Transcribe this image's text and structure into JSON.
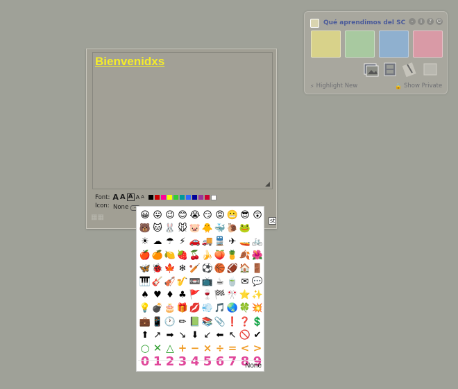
{
  "widget": {
    "title": "Qué aprendimos del SC",
    "swatch_colors": [
      "#d8d28a",
      "#a8c9a0",
      "#8fb0cf",
      "#d99aa6"
    ],
    "controls": [
      "-",
      "i",
      "?",
      "⏻"
    ],
    "highlight_label": "Highlight New",
    "show_label": "Show Private"
  },
  "note": {
    "heading": "Bienvenidxs",
    "heading_color": "#f4ec2a",
    "font_label": "Font:",
    "font_sizes": [
      "A",
      "A",
      "A",
      "A",
      "A"
    ],
    "colors": [
      "#000000",
      "#cc0000",
      "#ff0099",
      "#ffff00",
      "#33cc33",
      "#009999",
      "#3366ff",
      "#000099",
      "#993399",
      "#cc0033",
      "#ffffff"
    ],
    "icon_label": "Icon:",
    "icon_value": "None",
    "more_label": "...",
    "tail_text": "st"
  },
  "picker": {
    "rows": [
      [
        {
          "t": "😀"
        },
        {
          "t": "😛"
        },
        {
          "t": "😉"
        },
        {
          "t": "😊"
        },
        {
          "t": "😭"
        },
        {
          "t": "😏"
        },
        {
          "t": "😡"
        },
        {
          "t": "😬"
        },
        {
          "t": "😎"
        },
        {
          "t": "😲"
        }
      ],
      [
        {
          "t": "🐻"
        },
        {
          "t": "🐱"
        },
        {
          "t": "🐰"
        },
        {
          "t": "🐭"
        },
        {
          "t": "🐷"
        },
        {
          "t": "🐥"
        },
        {
          "t": "🐳"
        },
        {
          "t": "🐌"
        },
        {
          "t": "🐸"
        },
        {
          "t": ""
        }
      ],
      [
        {
          "t": "☀"
        },
        {
          "t": "☁"
        },
        {
          "t": "☂"
        },
        {
          "t": "⚡"
        },
        {
          "t": "🚗"
        },
        {
          "t": "🚚"
        },
        {
          "t": "🚆"
        },
        {
          "t": "✈"
        },
        {
          "t": "🚤"
        },
        {
          "t": "🚲"
        }
      ],
      [
        {
          "t": "🍎"
        },
        {
          "t": "🍊"
        },
        {
          "t": "🍋"
        },
        {
          "t": "🍓"
        },
        {
          "t": "🍒"
        },
        {
          "t": "🍌"
        },
        {
          "t": "🍑"
        },
        {
          "t": "🍍"
        },
        {
          "t": "🍂"
        },
        {
          "t": "🌺"
        }
      ],
      [
        {
          "t": "🦋"
        },
        {
          "t": "🐞"
        },
        {
          "t": "🍁"
        },
        {
          "t": "❄"
        },
        {
          "t": "🏏"
        },
        {
          "t": "⚽"
        },
        {
          "t": "🏀"
        },
        {
          "t": "🏈"
        },
        {
          "t": "🏠"
        },
        {
          "t": "🚪"
        }
      ],
      [
        {
          "t": "🎹"
        },
        {
          "t": "🎸"
        },
        {
          "t": "🎻"
        },
        {
          "t": "🎷"
        },
        {
          "t": "📼"
        },
        {
          "t": "📺"
        },
        {
          "t": "☕"
        },
        {
          "t": "🍵"
        },
        {
          "t": "✉"
        },
        {
          "t": "💬"
        }
      ],
      [
        {
          "t": "♠"
        },
        {
          "t": "♥"
        },
        {
          "t": "♦"
        },
        {
          "t": "♣"
        },
        {
          "t": "🚩"
        },
        {
          "t": "🍷"
        },
        {
          "t": "🏁"
        },
        {
          "t": "🎌"
        },
        {
          "t": "⭐"
        },
        {
          "t": "✨"
        }
      ],
      [
        {
          "t": "💡"
        },
        {
          "t": "💣"
        },
        {
          "t": "🎂"
        },
        {
          "t": "🎁"
        },
        {
          "t": "💋"
        },
        {
          "t": "💨"
        },
        {
          "t": "🎵"
        },
        {
          "t": "🌏"
        },
        {
          "t": "🍀"
        },
        {
          "t": "💥"
        }
      ],
      [
        {
          "t": "💼"
        },
        {
          "t": "📱"
        },
        {
          "t": "🕐"
        },
        {
          "t": "✏"
        },
        {
          "t": "📗"
        },
        {
          "t": "📚"
        },
        {
          "t": "📎"
        },
        {
          "t": "❗"
        },
        {
          "t": "❓"
        },
        {
          "t": "💲"
        }
      ],
      [
        {
          "t": "⬆"
        },
        {
          "t": "↗"
        },
        {
          "t": "➡"
        },
        {
          "t": "↘"
        },
        {
          "t": "⬇"
        },
        {
          "t": "↙"
        },
        {
          "t": "⬅"
        },
        {
          "t": "↖"
        },
        {
          "t": "🚫"
        },
        {
          "t": "✔"
        }
      ],
      [
        {
          "t": "○",
          "c": "#2e9e2e"
        },
        {
          "t": "✕",
          "c": "#2e9e2e"
        },
        {
          "t": "△",
          "c": "#2e9e2e"
        },
        {
          "t": "+",
          "c": "#f09a22"
        },
        {
          "t": "−",
          "c": "#f09a22"
        },
        {
          "t": "×",
          "c": "#f09a22"
        },
        {
          "t": "÷",
          "c": "#f09a22"
        },
        {
          "t": "=",
          "c": "#f09a22"
        },
        {
          "t": "<",
          "c": "#f09a22"
        },
        {
          "t": ">",
          "c": "#f09a22"
        }
      ],
      [
        {
          "t": "0",
          "n": true
        },
        {
          "t": "1",
          "n": true
        },
        {
          "t": "2",
          "n": true
        },
        {
          "t": "3",
          "n": true
        },
        {
          "t": "4",
          "n": true
        },
        {
          "t": "5",
          "n": true
        },
        {
          "t": "6",
          "n": true
        },
        {
          "t": "7",
          "n": true
        },
        {
          "t": "8",
          "n": true
        },
        {
          "t": "9",
          "n": true
        }
      ]
    ],
    "none_label": "None"
  }
}
